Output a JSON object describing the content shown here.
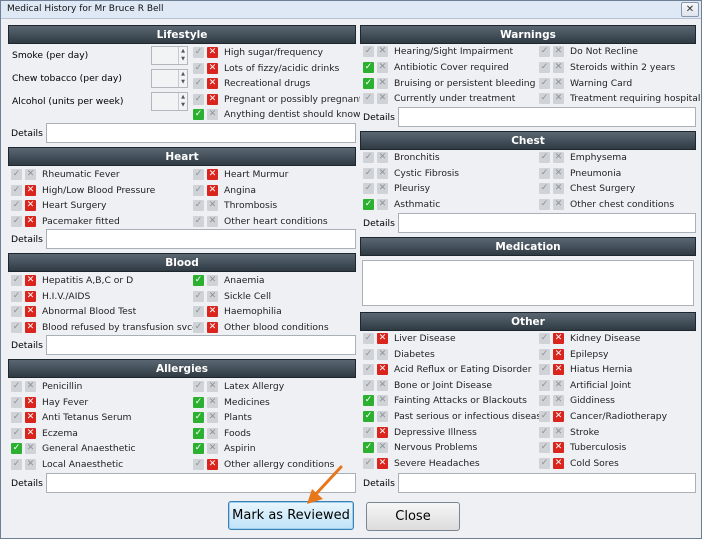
{
  "window": {
    "title": "Medical History for Mr Bruce R Bell",
    "close_glyph": "✕"
  },
  "lifestyle": {
    "title": "Lifestyle",
    "fields": [
      {
        "label": "Smoke (per day)",
        "value": ""
      },
      {
        "label": "Chew tobacco (per day)",
        "value": ""
      },
      {
        "label": "Alcohol (units per week)",
        "value": ""
      }
    ],
    "items": [
      {
        "label": "High sugar/frequency",
        "yes": false,
        "no": true
      },
      {
        "label": "Lots of fizzy/acidic drinks",
        "yes": false,
        "no": true
      },
      {
        "label": "Recreational drugs",
        "yes": false,
        "no": true
      },
      {
        "label": "Pregnant or possibly pregnant",
        "yes": false,
        "no": true
      },
      {
        "label": "Anything dentist should know",
        "yes": true,
        "no": false
      }
    ],
    "details_label": "Details"
  },
  "heart": {
    "title": "Heart",
    "left": [
      {
        "label": "Rheumatic Fever",
        "yes": false,
        "no": false
      },
      {
        "label": "High/Low Blood Pressure",
        "yes": false,
        "no": true
      },
      {
        "label": "Heart Surgery",
        "yes": false,
        "no": true
      },
      {
        "label": "Pacemaker fitted",
        "yes": false,
        "no": true
      }
    ],
    "right": [
      {
        "label": "Heart Murmur",
        "yes": false,
        "no": true
      },
      {
        "label": "Angina",
        "yes": false,
        "no": true
      },
      {
        "label": "Thrombosis",
        "yes": false,
        "no": false
      },
      {
        "label": "Other heart conditions",
        "yes": false,
        "no": false
      }
    ],
    "details_label": "Details"
  },
  "blood": {
    "title": "Blood",
    "left": [
      {
        "label": "Hepatitis A,B,C or D",
        "yes": false,
        "no": true
      },
      {
        "label": "H.I.V./AIDS",
        "yes": false,
        "no": true
      },
      {
        "label": "Abnormal Blood Test",
        "yes": false,
        "no": true
      },
      {
        "label": "Blood refused by transfusion svce.",
        "yes": false,
        "no": true
      }
    ],
    "right": [
      {
        "label": "Anaemia",
        "yes": true,
        "no": false
      },
      {
        "label": "Sickle Cell",
        "yes": false,
        "no": false
      },
      {
        "label": "Haemophilia",
        "yes": false,
        "no": true
      },
      {
        "label": "Other blood conditions",
        "yes": false,
        "no": true
      }
    ],
    "details_label": "Details"
  },
  "allergies": {
    "title": "Allergies",
    "left": [
      {
        "label": "Penicillin",
        "yes": false,
        "no": false
      },
      {
        "label": "Hay Fever",
        "yes": false,
        "no": true
      },
      {
        "label": "Anti Tetanus Serum",
        "yes": false,
        "no": true
      },
      {
        "label": "Eczema",
        "yes": false,
        "no": true
      },
      {
        "label": "General Anaesthetic",
        "yes": true,
        "no": false
      },
      {
        "label": "Local Anaesthetic",
        "yes": false,
        "no": false
      }
    ],
    "right": [
      {
        "label": "Latex Allergy",
        "yes": false,
        "no": false
      },
      {
        "label": "Medicines",
        "yes": true,
        "no": false
      },
      {
        "label": "Plants",
        "yes": true,
        "no": false
      },
      {
        "label": "Foods",
        "yes": true,
        "no": false
      },
      {
        "label": "Aspirin",
        "yes": true,
        "no": false
      },
      {
        "label": "Other allergy conditions",
        "yes": false,
        "no": true
      }
    ],
    "details_label": "Details"
  },
  "warnings": {
    "title": "Warnings",
    "left": [
      {
        "label": "Hearing/Sight Impairment",
        "yes": false,
        "no": false
      },
      {
        "label": "Antibiotic Cover required",
        "yes": true,
        "no": false
      },
      {
        "label": "Bruising or persistent bleeding",
        "yes": true,
        "no": false
      },
      {
        "label": "Currently under treatment",
        "yes": false,
        "no": false
      }
    ],
    "right": [
      {
        "label": "Do Not Recline",
        "yes": false,
        "no": false
      },
      {
        "label": "Steroids within 2 years",
        "yes": false,
        "no": false
      },
      {
        "label": "Warning Card",
        "yes": false,
        "no": false
      },
      {
        "label": "Treatment requiring hospital",
        "yes": false,
        "no": false
      }
    ],
    "details_label": "Details"
  },
  "chest": {
    "title": "Chest",
    "left": [
      {
        "label": "Bronchitis",
        "yes": false,
        "no": false
      },
      {
        "label": "Cystic Fibrosis",
        "yes": false,
        "no": false
      },
      {
        "label": "Pleurisy",
        "yes": false,
        "no": false
      },
      {
        "label": "Asthmatic",
        "yes": true,
        "no": false
      }
    ],
    "right": [
      {
        "label": "Emphysema",
        "yes": false,
        "no": false
      },
      {
        "label": "Pneumonia",
        "yes": false,
        "no": false
      },
      {
        "label": "Chest Surgery",
        "yes": false,
        "no": false
      },
      {
        "label": "Other chest conditions",
        "yes": false,
        "no": false
      }
    ],
    "details_label": "Details"
  },
  "medication": {
    "title": "Medication",
    "value": ""
  },
  "other": {
    "title": "Other",
    "left": [
      {
        "label": "Liver Disease",
        "yes": false,
        "no": true
      },
      {
        "label": "Diabetes",
        "yes": false,
        "no": false
      },
      {
        "label": "Acid Reflux or Eating Disorder",
        "yes": false,
        "no": true
      },
      {
        "label": "Bone or Joint Disease",
        "yes": false,
        "no": false
      },
      {
        "label": "Fainting Attacks or Blackouts",
        "yes": true,
        "no": false
      },
      {
        "label": "Past serious or infectious disease",
        "yes": true,
        "no": false
      },
      {
        "label": "Depressive Illness",
        "yes": false,
        "no": true
      },
      {
        "label": "Nervous Problems",
        "yes": true,
        "no": false
      },
      {
        "label": "Severe Headaches",
        "yes": false,
        "no": true
      }
    ],
    "right": [
      {
        "label": "Kidney Disease",
        "yes": false,
        "no": true
      },
      {
        "label": "Epilepsy",
        "yes": false,
        "no": true
      },
      {
        "label": "Hiatus Hernia",
        "yes": false,
        "no": true
      },
      {
        "label": "Artificial Joint",
        "yes": false,
        "no": false
      },
      {
        "label": "Giddiness",
        "yes": false,
        "no": false
      },
      {
        "label": "Cancer/Radiotherapy",
        "yes": false,
        "no": true
      },
      {
        "label": "Stroke",
        "yes": false,
        "no": false
      },
      {
        "label": "Tuberculosis",
        "yes": false,
        "no": true
      },
      {
        "label": "Cold Sores",
        "yes": false,
        "no": true
      }
    ],
    "details_label": "Details"
  },
  "buttons": {
    "review": "Mark as Reviewed",
    "close": "Close"
  },
  "colors": {
    "yes": "#2bb12f",
    "no": "#d9251d",
    "arrow": "#e8761a"
  }
}
